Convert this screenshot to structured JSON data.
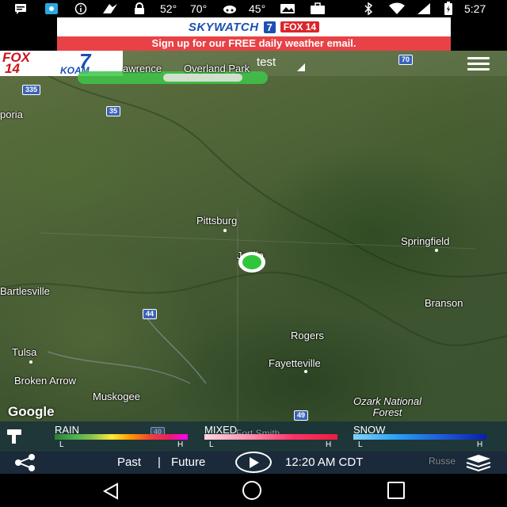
{
  "status_bar": {
    "temp1": "52°",
    "temp2": "70°",
    "temp3": "45°",
    "time": "5:27",
    "icons": [
      "message-icon",
      "app-icon",
      "info-icon",
      "fox-icon",
      "lock-icon",
      "cloud-icon",
      "photo-icon",
      "briefcase-icon",
      "bluetooth-icon",
      "wifi-icon",
      "signal-icon",
      "battery-icon"
    ]
  },
  "ad": {
    "brand": "SKYWATCH",
    "channel": "7",
    "station": "FOX 14",
    "station_sub": "KOAM",
    "tagline": "Sign up for our FREE daily weather email."
  },
  "header": {
    "logo_fox": "FOX",
    "logo_14": "14",
    "logo_7": "7",
    "logo_koam": "KOAM",
    "location_title": "test",
    "menu_icon": "hamburger-menu-icon"
  },
  "map": {
    "places": {
      "lawrence": "awrence",
      "overland_park": "Overland Park",
      "emporia": "poria",
      "pittsburg": "Pittsburg",
      "joplin": "Joplin",
      "springfield": "Springfield",
      "bartlesville": "Bartlesville",
      "branson": "Branson",
      "rogers": "Rogers",
      "fayetteville": "Fayetteville",
      "tulsa": "Tulsa",
      "broken_arrow": "Broken Arrow",
      "muskogee": "Muskogee",
      "ozark": "Ozark National\nForest",
      "fort_smith": "Fort Smith",
      "russellville": "Russe"
    },
    "highways": {
      "h70": "70",
      "h335": "335",
      "h35": "35",
      "h44": "44",
      "h40": "40",
      "h49": "49"
    },
    "attribution": "Google"
  },
  "legend": {
    "rain": "RAIN",
    "mixed": "MIXED",
    "snow": "SNOW",
    "low": "L",
    "high": "H",
    "colors": {
      "rain": [
        "#2e7d32",
        "#4caf50",
        "#8bc34a",
        "#ffeb3b",
        "#ff9800",
        "#f44336",
        "#e91e63",
        "#ff00ff"
      ],
      "mixed": [
        "#ffd6e0",
        "#ff8fb0",
        "#ff3366",
        "#e91e3f"
      ],
      "snow": [
        "#7fd4ff",
        "#2a9df4",
        "#1e5bd8",
        "#0a1ea8"
      ]
    }
  },
  "controls": {
    "past": "Past",
    "separator": "|",
    "future": "Future",
    "time": "12:20 AM CDT",
    "share_icon": "share-icon",
    "play_icon": "play-icon",
    "layers_icon": "layers-icon"
  },
  "nav": {
    "back_icon": "back-icon",
    "home_icon": "home-icon",
    "recent_icon": "recent-apps-icon"
  }
}
